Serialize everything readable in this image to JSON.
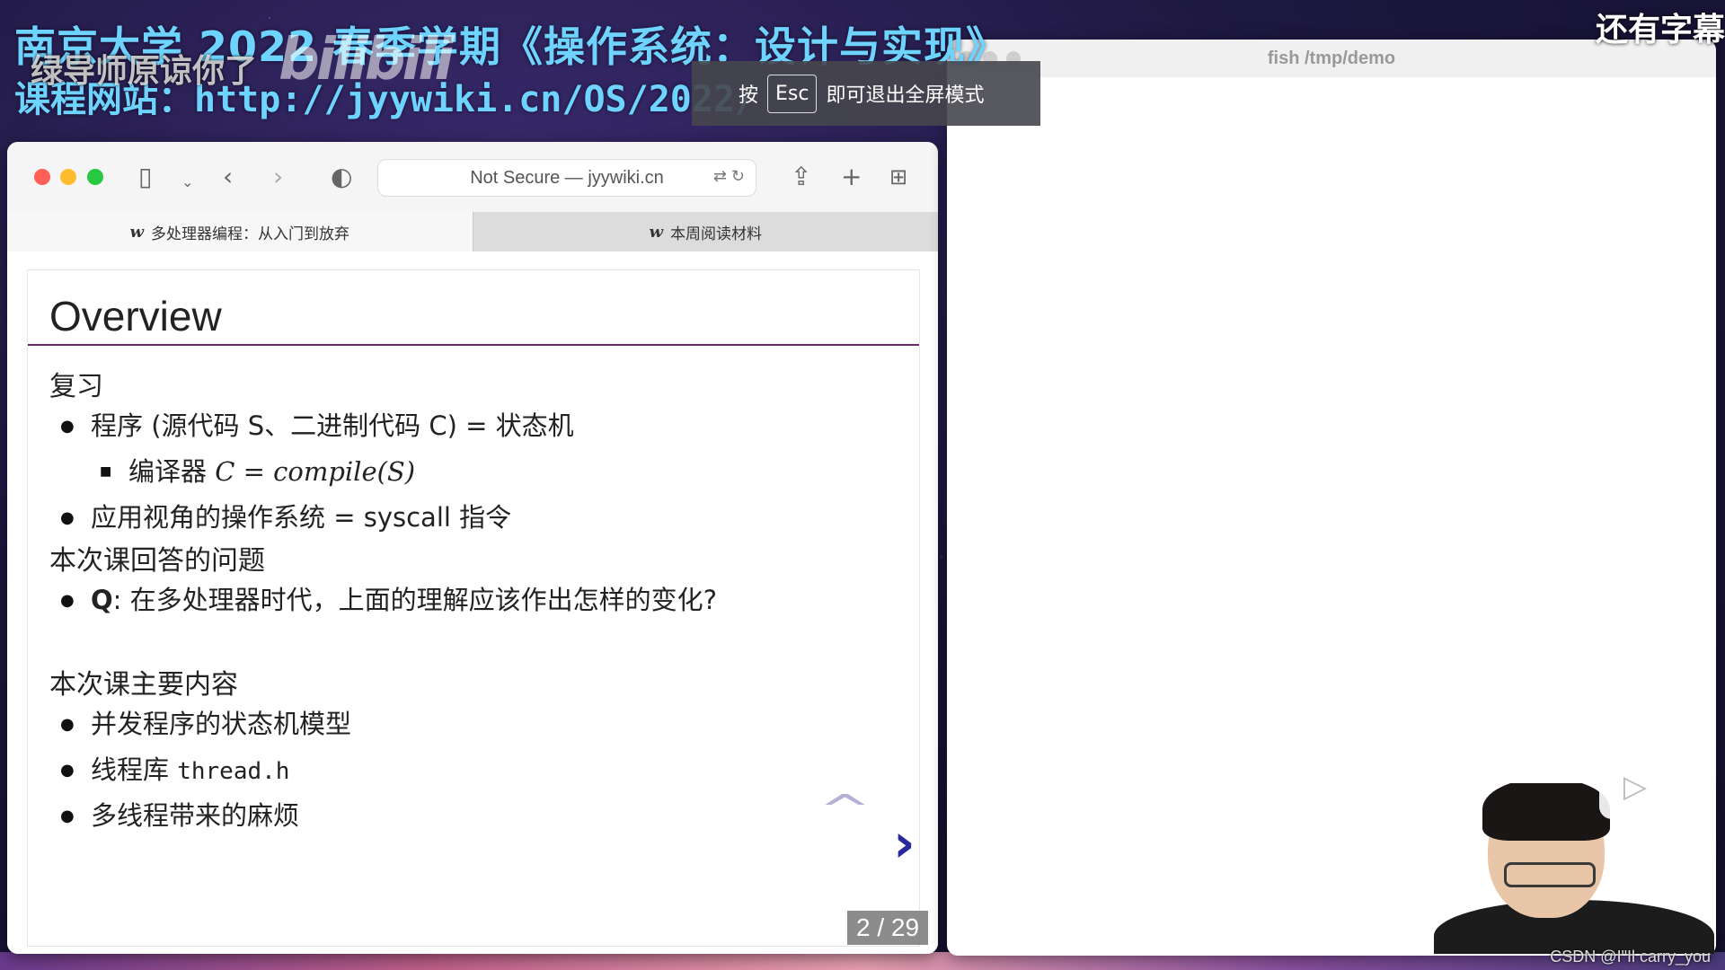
{
  "overlay": {
    "course_title": "南京大学 2022 春季学期《操作系统：设计与实现》",
    "course_site": "课程网站：http://jyywiki.cn/OS/2022/",
    "danmaku": "绿导师原谅你了",
    "bili_logo": "bilibili",
    "top_right_subtitle": "还有字幕",
    "watermark": "CSDN @I\"Il  carry_you"
  },
  "esc_tip": {
    "press": "按",
    "key": "Esc",
    "message": "即可退出全屏模式"
  },
  "safari": {
    "address": "Not Secure — jyywiki.cn",
    "tabs": [
      {
        "label": "多处理器编程：从入门到放弃",
        "icon": "w"
      },
      {
        "label": "本周阅读材料",
        "icon": "w"
      }
    ]
  },
  "slide": {
    "title": "Overview",
    "section1": "复习",
    "bullets1": [
      "程序 (源代码 S、二进制代码 C) = 状态机",
      "应用视角的操作系统 = syscall 指令"
    ],
    "sub_bullet_prefix": "编译器 ",
    "sub_bullet_math": "C = compile(S)",
    "section2": "本次课回答的问题",
    "q_label": "Q",
    "q_text": ": 在多处理器时代，上面的理解应该作出怎样的变化?",
    "section3": "本次课主要内容",
    "bullets3": [
      "并发程序的状态机模型",
      "线程库 ",
      "多线程带来的麻烦"
    ],
    "thread_h": "thread.h",
    "page_counter": "2 / 29"
  },
  "terminal": {
    "title": "fish /tmp/demo"
  }
}
